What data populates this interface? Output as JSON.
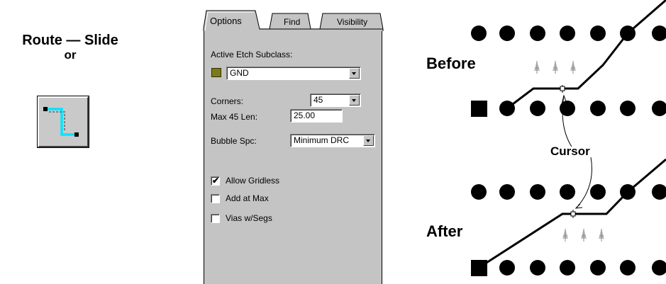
{
  "left": {
    "title": "Route — Slide",
    "subtitle": "or",
    "tool_icon": "route-slide-tool-icon"
  },
  "panel": {
    "tabs": [
      {
        "label": "Options",
        "active": true
      },
      {
        "label": "Find",
        "active": false
      },
      {
        "label": "Visibility",
        "active": false
      }
    ],
    "active_etch_label": "Active Etch Subclass:",
    "subclass_value": "GND",
    "subclass_color": "#7a7a1c",
    "corners_label": "Corners:",
    "corners_value": "45",
    "max45_label": "Max 45 Len:",
    "max45_value": "25.00",
    "bubble_label": "Bubble Spc:",
    "bubble_value": "Minimum DRC",
    "checkboxes": [
      {
        "label": "Allow Gridless",
        "checked": true
      },
      {
        "label": "Add at Max",
        "checked": false
      },
      {
        "label": "Vias w/Segs",
        "checked": false
      }
    ]
  },
  "diagram": {
    "before_label": "Before",
    "after_label": "After",
    "cursor_label": "Cursor"
  }
}
